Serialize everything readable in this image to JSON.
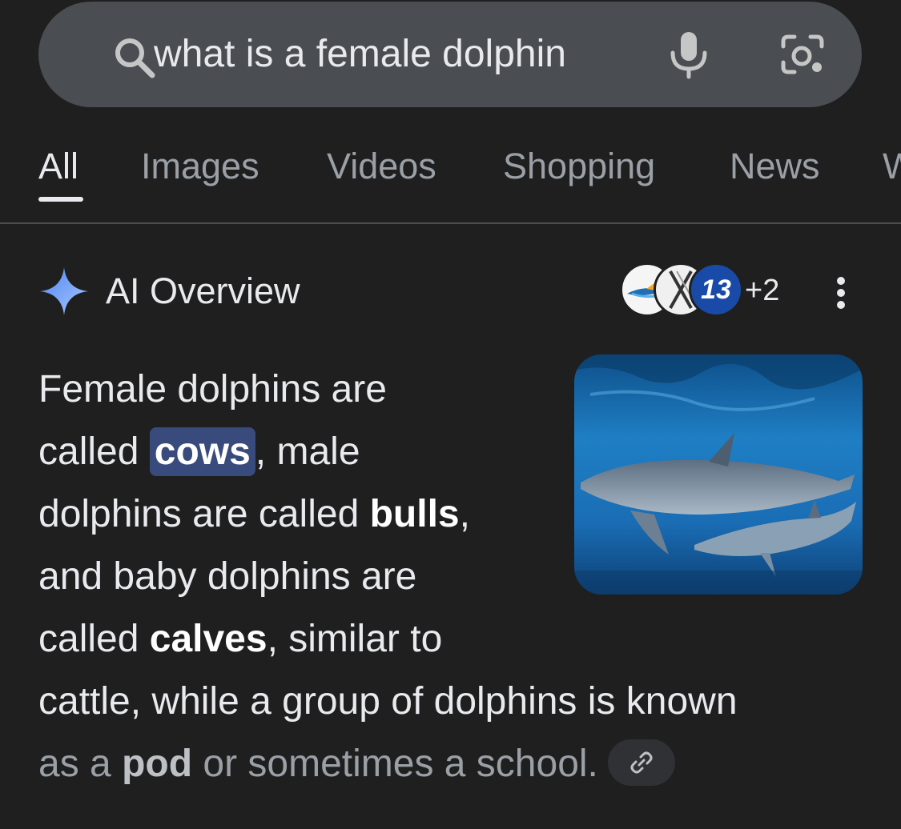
{
  "search": {
    "query": "what is a female dolphin"
  },
  "tabs": [
    {
      "label": "All",
      "active": true
    },
    {
      "label": "Images"
    },
    {
      "label": "Videos"
    },
    {
      "label": "Shopping"
    },
    {
      "label": "News"
    },
    {
      "label": "W"
    }
  ],
  "ai_overview": {
    "title": "AI Overview",
    "sources": {
      "badge_text": "13",
      "more_count": "+2"
    },
    "image_description_icon": "dolphins-photo",
    "answer": {
      "l1": "Female dolphins are",
      "l2_a": "called ",
      "l2_b": "cows",
      "l2_c": ", male",
      "l3_a": "dolphins are called ",
      "l3_b": "bulls",
      "l3_c": ",",
      "l4": "and baby dolphins are",
      "l5_a": "called ",
      "l5_b": "calves",
      "l5_c": ", similar to",
      "l6": "cattle, while a group of dolphins is known",
      "l7_a": "as a ",
      "l7_b": "pod",
      "l7_c": " or sometimes a school."
    }
  },
  "colors": {
    "background": "#1f1f1f",
    "search_bar": "#4a4d51",
    "highlight": "#394a7d",
    "accent_sparkle": "#8ab4f8"
  }
}
